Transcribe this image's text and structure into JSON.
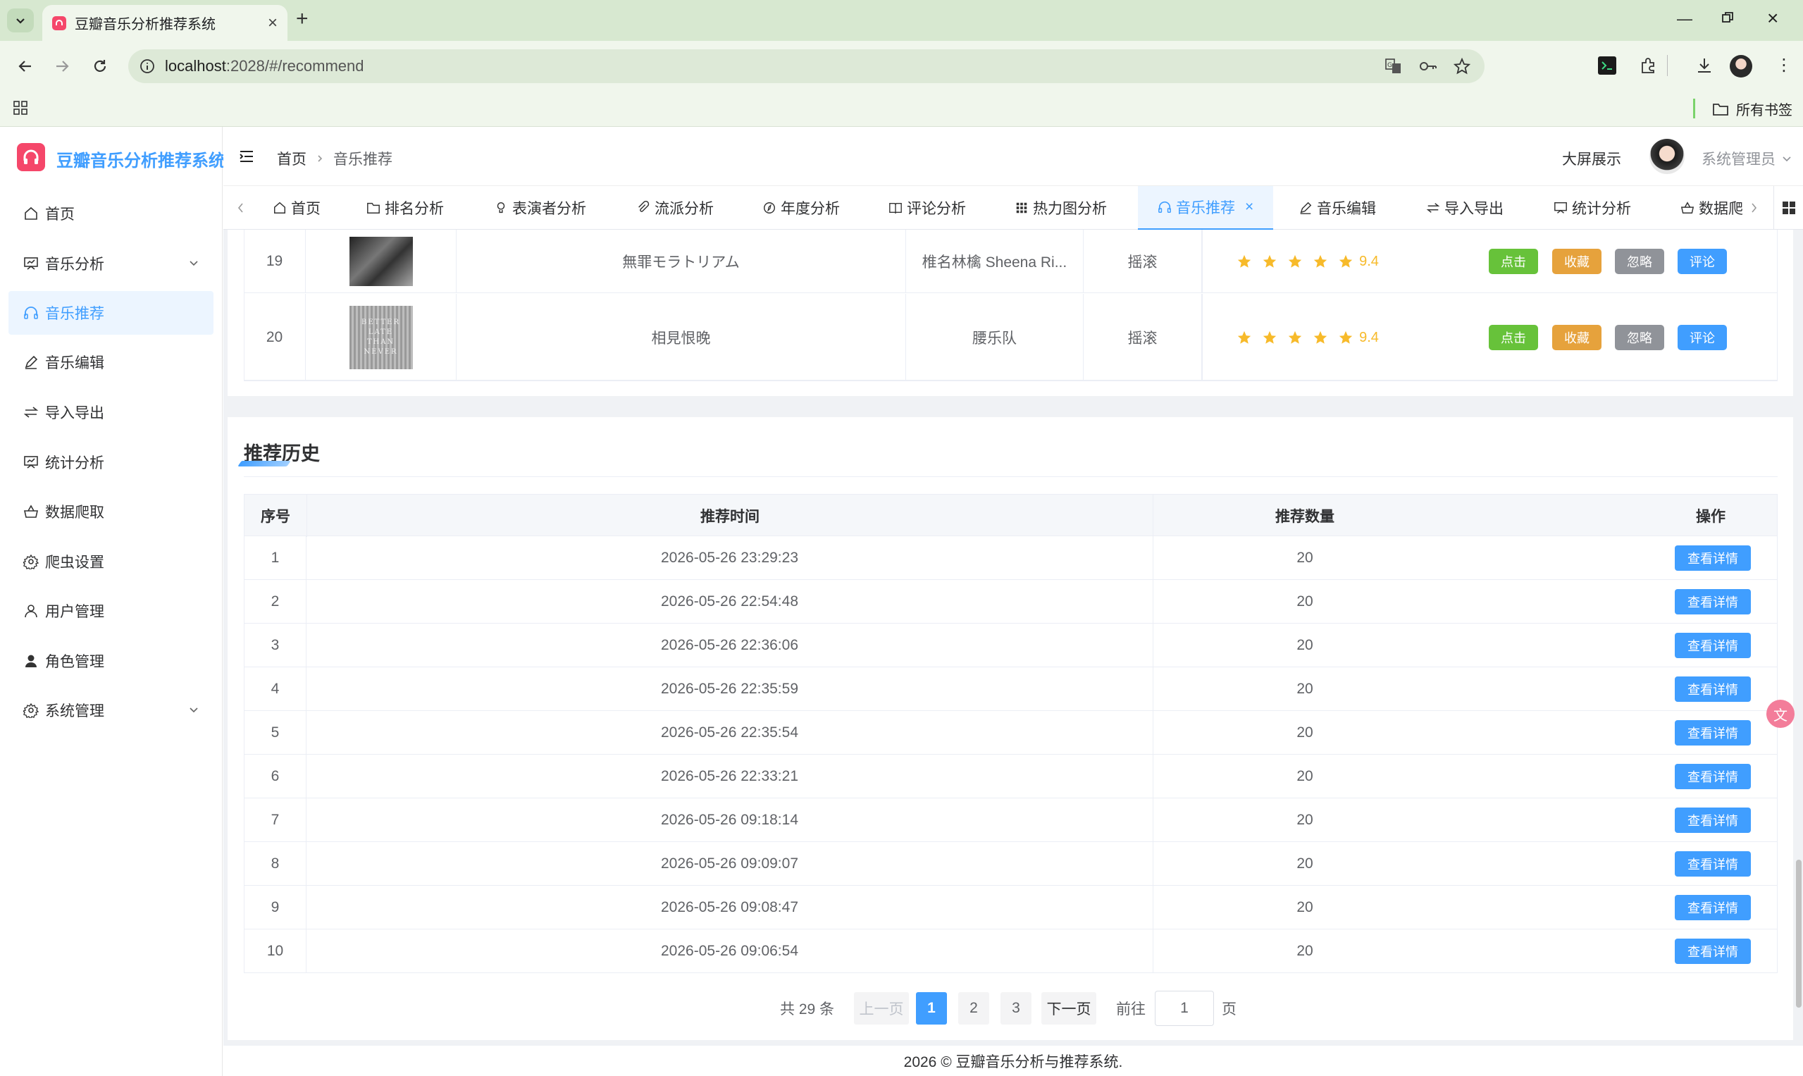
{
  "browser": {
    "tab_title": "豆瓣音乐分析推荐系统",
    "url_host": "localhost",
    "url_path": ":2028/#/recommend",
    "bookmarks_label": "所有书签"
  },
  "app": {
    "logo_text": "豆瓣音乐分析推荐系统",
    "breadcrumb": [
      "首页",
      "音乐推荐"
    ],
    "screen_label": "大屏展示",
    "user_name": "系统管理员",
    "accent": "#409eff",
    "footer": "2026 © 豆瓣音乐分析与推荐系统."
  },
  "sidebar": {
    "items": [
      {
        "label": "首页",
        "icon": "home-icon"
      },
      {
        "label": "音乐分析",
        "icon": "chart-board-icon"
      },
      {
        "label": "音乐推荐",
        "icon": "headphones-icon"
      },
      {
        "label": "音乐编辑",
        "icon": "edit-icon"
      },
      {
        "label": "导入导出",
        "icon": "swap-icon"
      },
      {
        "label": "统计分析",
        "icon": "chart-board-icon"
      },
      {
        "label": "数据爬取",
        "icon": "basket-icon"
      },
      {
        "label": "爬虫设置",
        "icon": "gear-icon"
      },
      {
        "label": "用户管理",
        "icon": "user-icon"
      },
      {
        "label": "角色管理",
        "icon": "user-filled-icon"
      },
      {
        "label": "系统管理",
        "icon": "gear-icon"
      }
    ]
  },
  "tags": [
    {
      "label": "首页"
    },
    {
      "label": "排名分析"
    },
    {
      "label": "表演者分析"
    },
    {
      "label": "流派分析"
    },
    {
      "label": "年度分析"
    },
    {
      "label": "评论分析"
    },
    {
      "label": "热力图分析"
    },
    {
      "label": "音乐推荐"
    },
    {
      "label": "音乐编辑"
    },
    {
      "label": "导入导出"
    },
    {
      "label": "统计分析"
    },
    {
      "label": "数据爬"
    }
  ],
  "recommend_rows": [
    {
      "no": "19",
      "title": "無罪モラトリアム",
      "artist": "椎名林檎 Sheena Ri...",
      "genre": "摇滚",
      "rating": 9.4,
      "score": "9.4",
      "cover_text": ""
    },
    {
      "no": "20",
      "title": "相見恨晚",
      "artist": "腰乐队",
      "genre": "摇滚",
      "rating": 9.4,
      "score": "9.4",
      "cover_text": "BETTER LATE THAN NEVER"
    }
  ],
  "row_actions": {
    "click": "点击",
    "fav": "收藏",
    "ignore": "忽略",
    "comment": "评论"
  },
  "history": {
    "title": "推荐历史",
    "headers": [
      "序号",
      "推荐时间",
      "推荐数量",
      "操作"
    ],
    "detail_label": "查看详情",
    "rows": [
      {
        "no": "1",
        "time": "2026-05-26 23:29:23",
        "count": "20"
      },
      {
        "no": "2",
        "time": "2026-05-26 22:54:48",
        "count": "20"
      },
      {
        "no": "3",
        "time": "2026-05-26 22:36:06",
        "count": "20"
      },
      {
        "no": "4",
        "time": "2026-05-26 22:35:59",
        "count": "20"
      },
      {
        "no": "5",
        "time": "2026-05-26 22:35:54",
        "count": "20"
      },
      {
        "no": "6",
        "time": "2026-05-26 22:33:21",
        "count": "20"
      },
      {
        "no": "7",
        "time": "2026-05-26 09:18:14",
        "count": "20"
      },
      {
        "no": "8",
        "time": "2026-05-26 09:09:07",
        "count": "20"
      },
      {
        "no": "9",
        "time": "2026-05-26 09:08:47",
        "count": "20"
      },
      {
        "no": "10",
        "time": "2026-05-26 09:06:54",
        "count": "20"
      }
    ]
  },
  "pagination": {
    "total": "共 29 条",
    "prev": "上一页",
    "pages": [
      "1",
      "2",
      "3"
    ],
    "current": "1",
    "next": "下一页",
    "goto_label": "前往",
    "goto_value": "1",
    "page_suffix": "页"
  }
}
